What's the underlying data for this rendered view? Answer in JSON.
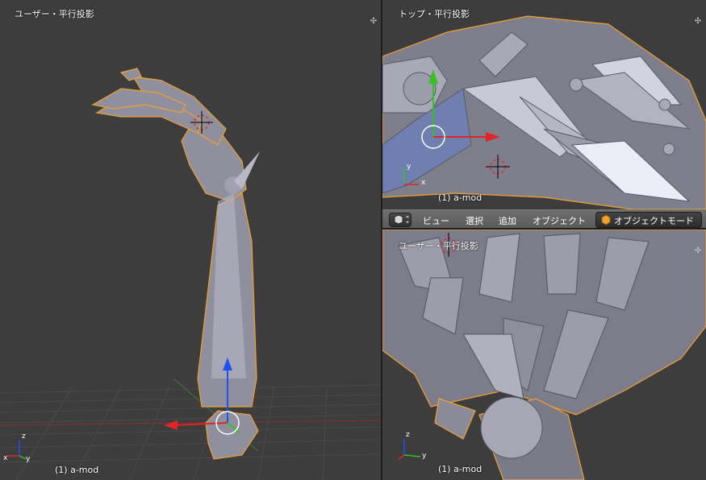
{
  "viewports": {
    "left": {
      "label": "ユーザー・平行投影",
      "object_label": "(1) a-mod"
    },
    "top_right": {
      "label": "トップ・平行投影",
      "object_label": "(1) a-mod"
    },
    "bottom_right": {
      "label": "ユーザー・平行投影",
      "object_label": "(1) a-mod"
    }
  },
  "header": {
    "menus": [
      "ビュー",
      "選択",
      "追加",
      "オブジェクト"
    ],
    "mode": "オブジェクトモード"
  },
  "axes": {
    "x": "x",
    "y": "y",
    "z": "z"
  },
  "colors": {
    "viewport_bg": "#3d3d3d",
    "mesh": "#8f8f9e",
    "outline": "#f0a030",
    "axis_x": "#e0242a",
    "axis_y": "#36c024",
    "axis_z": "#2050f0"
  }
}
